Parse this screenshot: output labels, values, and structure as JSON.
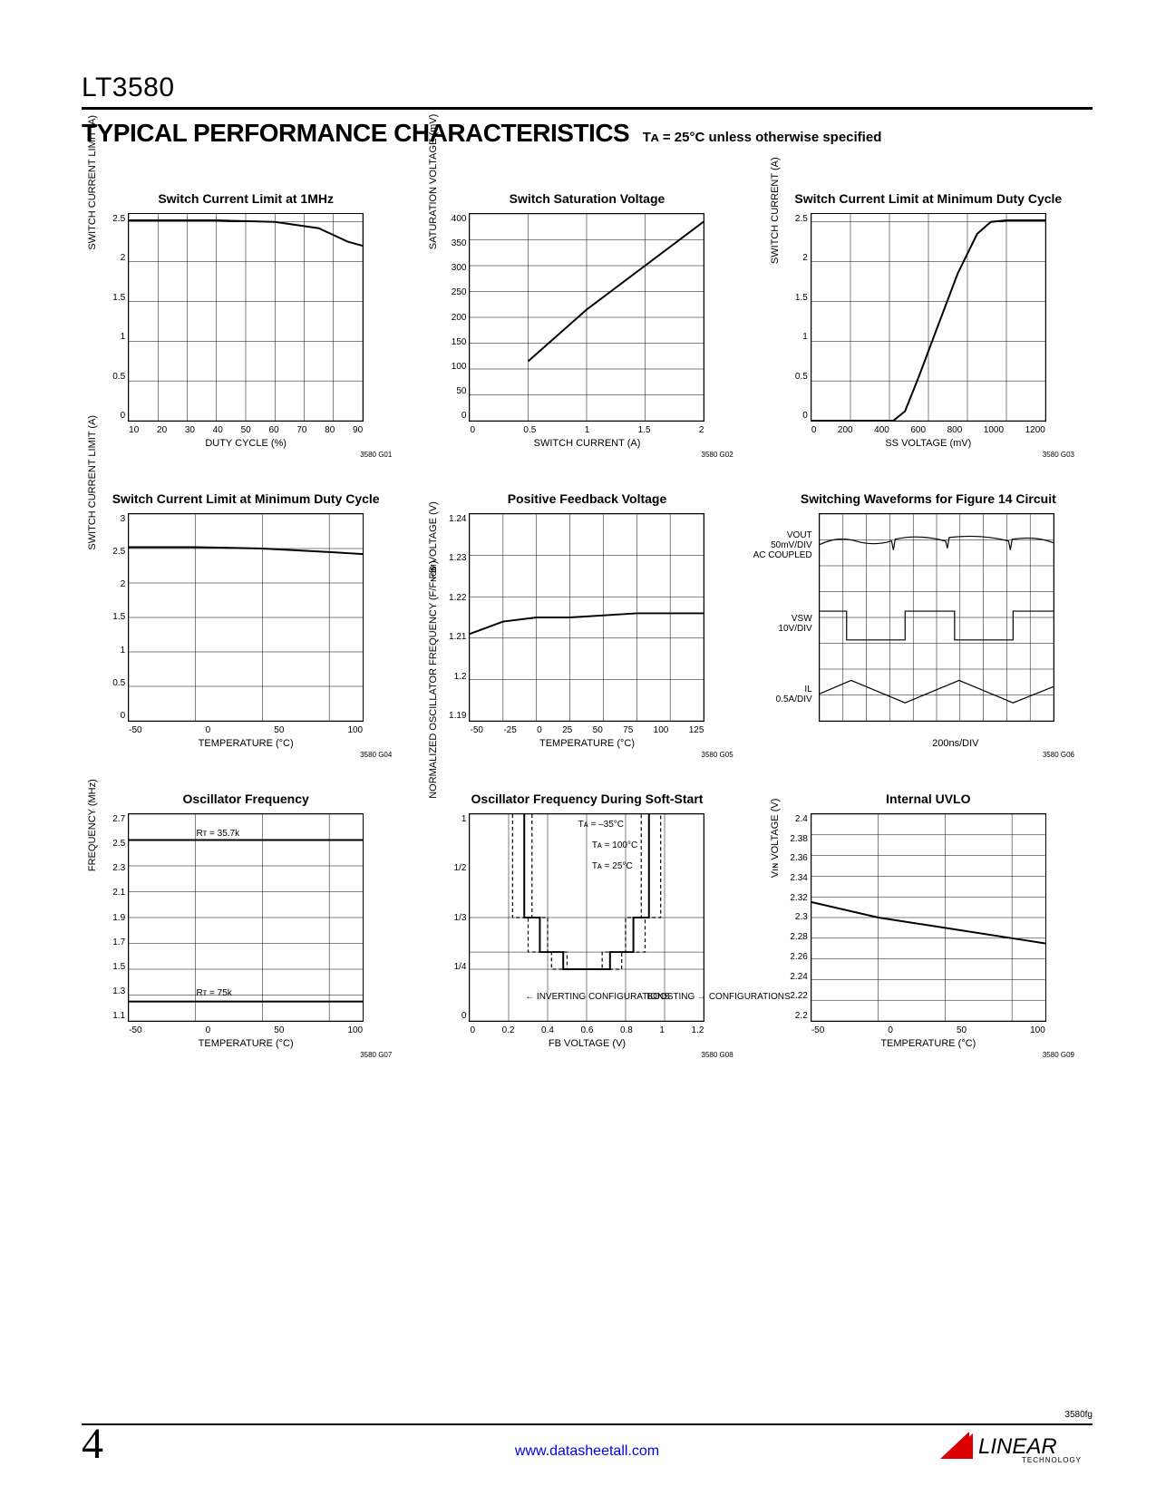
{
  "header": {
    "part_number": "LT3580",
    "section_title": "TYPICAL PERFORMANCE CHARACTERISTICS",
    "condition": "Tᴀ = 25°C unless otherwise specified"
  },
  "chart_data": [
    {
      "id": "c1",
      "figid": "3580 G01",
      "type": "line",
      "title": "Switch Current Limit at 1MHz",
      "xlabel": "DUTY CYCLE (%)",
      "ylabel": "SWITCH CURRENT LIMIT (A)",
      "xlim": [
        10,
        90
      ],
      "ylim": [
        0,
        2.6
      ],
      "xticks": [
        10,
        20,
        30,
        40,
        50,
        60,
        70,
        80,
        90
      ],
      "yticks": [
        0,
        0.5,
        1.0,
        1.5,
        2.0,
        2.5
      ],
      "series": [
        {
          "name": "",
          "x": [
            10,
            40,
            60,
            75,
            85,
            90
          ],
          "y": [
            2.52,
            2.52,
            2.5,
            2.42,
            2.25,
            2.2
          ]
        }
      ]
    },
    {
      "id": "c2",
      "figid": "3580 G02",
      "type": "line",
      "title": "Switch Saturation Voltage",
      "xlabel": "SWITCH CURRENT (A)",
      "ylabel": "SATURATION VOLTAGE (mV)",
      "xlim": [
        0,
        2
      ],
      "ylim": [
        0,
        400
      ],
      "xticks": [
        0,
        0.5,
        1,
        1.5,
        2
      ],
      "yticks": [
        0,
        50,
        100,
        150,
        200,
        250,
        300,
        350,
        400
      ],
      "series": [
        {
          "name": "",
          "x": [
            0.5,
            1.0,
            1.5,
            2.0
          ],
          "y": [
            115,
            215,
            300,
            385
          ]
        }
      ]
    },
    {
      "id": "c3",
      "figid": "3580 G03",
      "type": "line",
      "title": "Switch Current Limit at Minimum Duty Cycle",
      "xlabel": "SS VOLTAGE (mV)",
      "ylabel": "SWITCH CURRENT (A)",
      "xlim": [
        0,
        1200
      ],
      "ylim": [
        0,
        2.6
      ],
      "xticks": [
        0,
        200,
        400,
        600,
        800,
        1000,
        1200
      ],
      "yticks": [
        0,
        0.5,
        1.0,
        1.5,
        2.0,
        2.5
      ],
      "series": [
        {
          "name": "",
          "x": [
            0,
            420,
            480,
            550,
            650,
            750,
            850,
            920,
            1000,
            1200
          ],
          "y": [
            0,
            0,
            0.12,
            0.55,
            1.2,
            1.85,
            2.35,
            2.5,
            2.52,
            2.52
          ]
        }
      ]
    },
    {
      "id": "c4",
      "figid": "3580 G04",
      "type": "line",
      "title": "Switch Current Limit at Minimum Duty Cycle",
      "xlabel": "TEMPERATURE (°C)",
      "ylabel": "SWITCH CURRENT LIMIT (A)",
      "xlim": [
        -50,
        125
      ],
      "ylim": [
        0,
        3.0
      ],
      "xticks": [
        -50,
        0,
        50,
        100
      ],
      "yticks": [
        0,
        0.5,
        1.0,
        1.5,
        2.0,
        2.5,
        3.0
      ],
      "series": [
        {
          "name": "",
          "x": [
            -50,
            0,
            50,
            100,
            125
          ],
          "y": [
            2.52,
            2.52,
            2.5,
            2.45,
            2.42
          ]
        }
      ]
    },
    {
      "id": "c5",
      "figid": "3580 G05",
      "type": "line",
      "title": "Positive Feedback Voltage",
      "xlabel": "TEMPERATURE (°C)",
      "ylabel": "FB VOLTAGE (V)",
      "xlim": [
        -50,
        125
      ],
      "ylim": [
        1.19,
        1.24
      ],
      "xticks": [
        -50,
        -25,
        0,
        25,
        50,
        75,
        100,
        125
      ],
      "yticks": [
        1.19,
        1.2,
        1.21,
        1.22,
        1.23,
        1.24
      ],
      "series": [
        {
          "name": "",
          "x": [
            -50,
            -25,
            0,
            25,
            75,
            125
          ],
          "y": [
            1.211,
            1.214,
            1.215,
            1.215,
            1.216,
            1.216
          ]
        }
      ]
    },
    {
      "id": "c6",
      "figid": "3580 G06",
      "type": "scope",
      "title": "Switching Waveforms for Figure 14 Circuit",
      "xlabel": "200ns/DIV",
      "traces": [
        {
          "name": "VOUT",
          "scale": "50mV/DIV",
          "note": "AC COUPLED"
        },
        {
          "name": "VSW",
          "scale": "10V/DIV"
        },
        {
          "name": "IL",
          "scale": "0.5A/DIV"
        }
      ]
    },
    {
      "id": "c7",
      "figid": "3580 G07",
      "type": "line",
      "title": "Oscillator Frequency",
      "xlabel": "TEMPERATURE (°C)",
      "ylabel": "FREQUENCY (MHz)",
      "xlim": [
        -50,
        125
      ],
      "ylim": [
        1.1,
        2.7
      ],
      "xticks": [
        -50,
        0,
        50,
        100
      ],
      "yticks": [
        1.1,
        1.3,
        1.5,
        1.7,
        1.9,
        2.1,
        2.3,
        2.5,
        2.7
      ],
      "series": [
        {
          "name": "RT = 35.7k",
          "x": [
            -50,
            125
          ],
          "y": [
            2.5,
            2.5
          ]
        },
        {
          "name": "RT = 75k",
          "x": [
            -50,
            125
          ],
          "y": [
            1.25,
            1.25
          ]
        }
      ],
      "annotations": [
        {
          "text": "Rᴛ = 35.7k",
          "x": 0,
          "y": 2.55
        },
        {
          "text": "Rᴛ = 75k",
          "x": 0,
          "y": 1.32
        }
      ]
    },
    {
      "id": "c8",
      "figid": "3580 G08",
      "type": "line",
      "title": "Oscillator Frequency During Soft-Start",
      "xlabel": "FB VOLTAGE (V)",
      "ylabel": "NORMALIZED OSCILLATOR FREQUENCY (F/Fɴᴏᴍ)",
      "xlim": [
        0,
        1.2
      ],
      "ylim": [
        0,
        1
      ],
      "xticks": [
        0,
        0.2,
        0.4,
        0.6,
        0.8,
        1.0,
        1.2
      ],
      "yticks_labels": [
        "0",
        "1/4",
        "1/3",
        "1/2",
        "1"
      ],
      "yticks": [
        0,
        0.25,
        0.333,
        0.5,
        1
      ],
      "annotations": [
        {
          "text": "Tᴀ = –35°C",
          "x": 0.55,
          "y": 0.95
        },
        {
          "text": "Tᴀ = 100°C",
          "x": 0.62,
          "y": 0.85
        },
        {
          "text": "Tᴀ = 25°C",
          "x": 0.62,
          "y": 0.75
        },
        {
          "text": "← INVERTING CONFIGURATIONS",
          "x": 0.28,
          "y": 0.12
        },
        {
          "text": "BOOSTING → CONFIGURATIONS",
          "x": 0.9,
          "y": 0.12
        }
      ],
      "series": [
        {
          "name": "25C",
          "style": "solid",
          "x": [
            0.28,
            0.28,
            0.36,
            0.36,
            0.48,
            0.48,
            0.72,
            0.72,
            0.84,
            0.84,
            0.92,
            0.92
          ],
          "y": [
            1.0,
            0.5,
            0.5,
            0.333,
            0.333,
            0.25,
            0.25,
            0.333,
            0.333,
            0.5,
            0.5,
            1.0
          ]
        },
        {
          "name": "-35C",
          "style": "dash",
          "x": [
            0.22,
            0.22,
            0.3,
            0.3,
            0.42,
            0.42,
            0.78,
            0.78,
            0.9,
            0.9,
            0.98,
            0.98
          ],
          "y": [
            1.0,
            0.5,
            0.5,
            0.333,
            0.333,
            0.25,
            0.25,
            0.333,
            0.333,
            0.5,
            0.5,
            1.0
          ]
        },
        {
          "name": "100C",
          "style": "dash",
          "x": [
            0.32,
            0.32,
            0.4,
            0.4,
            0.5,
            0.5,
            0.68,
            0.68,
            0.8,
            0.8,
            0.88,
            0.88
          ],
          "y": [
            1.0,
            0.5,
            0.5,
            0.333,
            0.333,
            0.25,
            0.25,
            0.333,
            0.333,
            0.5,
            0.5,
            1.0
          ]
        }
      ]
    },
    {
      "id": "c9",
      "figid": "3580 G09",
      "type": "line",
      "title": "Internal UVLO",
      "xlabel": "TEMPERATURE (°C)",
      "ylabel": "Vıɴ VOLTAGE (V)",
      "xlim": [
        -50,
        125
      ],
      "ylim": [
        2.2,
        2.4
      ],
      "xticks": [
        -50,
        0,
        50,
        100
      ],
      "yticks": [
        2.2,
        2.22,
        2.24,
        2.26,
        2.28,
        2.3,
        2.32,
        2.34,
        2.36,
        2.38,
        2.4
      ],
      "series": [
        {
          "name": "",
          "x": [
            -50,
            0,
            50,
            100,
            125
          ],
          "y": [
            2.315,
            2.3,
            2.29,
            2.28,
            2.275
          ]
        }
      ]
    }
  ],
  "footer": {
    "doc_id": "3580fg",
    "url": "www.datasheetall.com",
    "page_number": "4",
    "logo_text": "LINEAR",
    "logo_sub": "TECHNOLOGY"
  }
}
